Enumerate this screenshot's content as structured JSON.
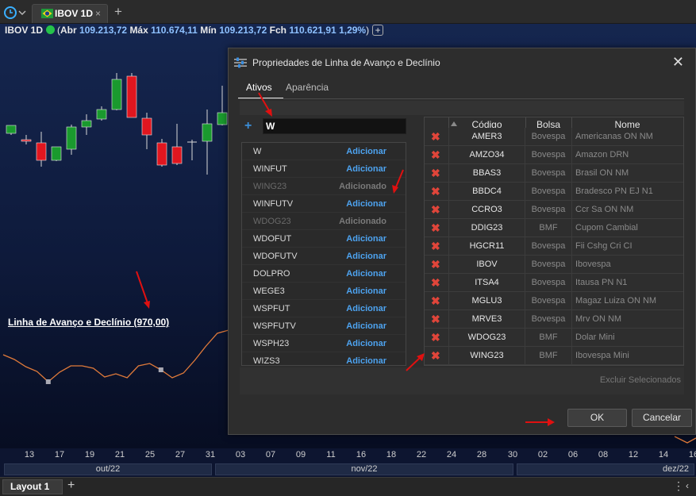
{
  "tabs": {
    "active_label": "IBOV 1D",
    "close_glyph": "×",
    "new_glyph": "+"
  },
  "chart": {
    "symbol": "IBOV 1D",
    "abr_label": "Abr",
    "abr": "109.213,72",
    "max_label": "Máx",
    "max": "110.674,11",
    "min_label": "Mín",
    "min": "109.213,72",
    "fch_label": "Fch",
    "fch": "110.621,91",
    "change": "1,29%",
    "indicator_label": "Linha de Avanço e Declínio (970,00)",
    "up_color": "#1a9a2e",
    "down_color": "#e0161f",
    "line_color": "#e07a3a",
    "candles": [
      {
        "o": 138,
        "h": 128,
        "l": 140,
        "c": 128
      },
      {
        "o": 146,
        "h": 140,
        "l": 152,
        "c": 148
      },
      {
        "o": 150,
        "h": 136,
        "l": 180,
        "c": 172
      },
      {
        "o": 172,
        "h": 155,
        "l": 173,
        "c": 155
      },
      {
        "o": 158,
        "h": 127,
        "l": 165,
        "c": 130
      },
      {
        "o": 130,
        "h": 114,
        "l": 140,
        "c": 122
      },
      {
        "o": 120,
        "h": 104,
        "l": 122,
        "c": 108
      },
      {
        "o": 108,
        "h": 62,
        "l": 109,
        "c": 70
      },
      {
        "o": 66,
        "h": 62,
        "l": 104,
        "c": 118
      },
      {
        "o": 119,
        "h": 112,
        "l": 158,
        "c": 140
      },
      {
        "o": 150,
        "h": 145,
        "l": 180,
        "c": 178
      },
      {
        "o": 155,
        "h": 126,
        "l": 178,
        "c": 176
      },
      {
        "o": 149,
        "h": 146,
        "l": 172,
        "c": 149
      },
      {
        "o": 148,
        "h": 108,
        "l": 190,
        "c": 126
      },
      {
        "o": 127,
        "h": 78,
        "l": 128,
        "c": 112
      }
    ],
    "ad_line": [
      417,
      423,
      432,
      438,
      451,
      439,
      431,
      431,
      434,
      445,
      441,
      446,
      431,
      428,
      436,
      446,
      440,
      424,
      406,
      390,
      386
    ]
  },
  "axis": {
    "days": [
      "13",
      "17",
      "19",
      "21",
      "25",
      "27",
      "31",
      "03",
      "07",
      "09",
      "11",
      "16",
      "18",
      "22",
      "24",
      "28",
      "30",
      "02",
      "06",
      "08",
      "12",
      "14",
      "16"
    ],
    "months": [
      "out/22",
      "nov/22",
      "dez/22"
    ]
  },
  "bottom": {
    "layout_label": "Layout 1",
    "add_glyph": "+",
    "dots_glyph": "⋮",
    "chevron_glyph": "‹"
  },
  "dialog": {
    "title": "Propriedades de Linha de Avanço e Declínio",
    "close_glyph": "✕",
    "tabs": [
      "Ativos",
      "Aparência"
    ],
    "search_value": "W",
    "plus_glyph": "+",
    "results": [
      {
        "code": "W",
        "action": "Adicionar",
        "added": false
      },
      {
        "code": "WINFUT",
        "action": "Adicionar",
        "added": false
      },
      {
        "code": "WING23",
        "action": "Adicionado",
        "added": true
      },
      {
        "code": "WINFUTV",
        "action": "Adicionar",
        "added": false
      },
      {
        "code": "WDOG23",
        "action": "Adicionado",
        "added": true
      },
      {
        "code": "WDOFUT",
        "action": "Adicionar",
        "added": false
      },
      {
        "code": "WDOFUTV",
        "action": "Adicionar",
        "added": false
      },
      {
        "code": "DOLPRO",
        "action": "Adicionar",
        "added": false
      },
      {
        "code": "WEGE3",
        "action": "Adicionar",
        "added": false
      },
      {
        "code": "WSPFUT",
        "action": "Adicionar",
        "added": false
      },
      {
        "code": "WSPFUTV",
        "action": "Adicionar",
        "added": false
      },
      {
        "code": "WSPH23",
        "action": "Adicionar",
        "added": false
      },
      {
        "code": "WIZS3",
        "action": "Adicionar",
        "added": false
      }
    ],
    "grid": {
      "headers": [
        "Código",
        "Bolsa",
        "Nome"
      ],
      "delete_glyph": "✖",
      "rows": [
        {
          "code": "AMER3",
          "exchange": "Bovespa",
          "name": "Americanas ON NM"
        },
        {
          "code": "AMZO34",
          "exchange": "Bovespa",
          "name": "Amazon DRN"
        },
        {
          "code": "BBAS3",
          "exchange": "Bovespa",
          "name": "Brasil ON NM"
        },
        {
          "code": "BBDC4",
          "exchange": "Bovespa",
          "name": "Bradesco PN EJ N1"
        },
        {
          "code": "CCRO3",
          "exchange": "Bovespa",
          "name": "Ccr Sa ON NM"
        },
        {
          "code": "DDIG23",
          "exchange": "BMF",
          "name": "Cupom Cambial"
        },
        {
          "code": "HGCR11",
          "exchange": "Bovespa",
          "name": "Fii Cshg Cri CI"
        },
        {
          "code": "IBOV",
          "exchange": "Bovespa",
          "name": "Ibovespa"
        },
        {
          "code": "ITSA4",
          "exchange": "Bovespa",
          "name": "Itausa PN N1"
        },
        {
          "code": "MGLU3",
          "exchange": "Bovespa",
          "name": "Magaz Luiza ON NM"
        },
        {
          "code": "MRVE3",
          "exchange": "Bovespa",
          "name": "Mrv ON NM"
        },
        {
          "code": "WDOG23",
          "exchange": "BMF",
          "name": "Dolar Mini"
        },
        {
          "code": "WING23",
          "exchange": "BMF",
          "name": "Ibovespa Mini"
        }
      ]
    },
    "excluir_label": "Excluir Selecionados",
    "ok_label": "OK",
    "cancel_label": "Cancelar"
  }
}
